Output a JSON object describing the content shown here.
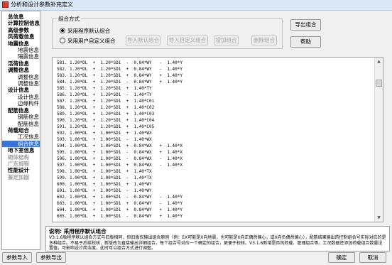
{
  "window": {
    "title": "分析和设计参数补充定义"
  },
  "sidebar": {
    "items": [
      {
        "label": "总信息",
        "level": 1,
        "state": "normal"
      },
      {
        "label": "计算控制信息",
        "level": 1,
        "state": "normal"
      },
      {
        "label": "高级参数",
        "level": 1,
        "state": "normal"
      },
      {
        "label": "风荷载信息",
        "level": 1,
        "state": "normal"
      },
      {
        "label": "地震信息",
        "level": 1,
        "state": "normal"
      },
      {
        "label": "地震信息",
        "level": 2,
        "state": "normal"
      },
      {
        "label": "隔震信息",
        "level": 2,
        "state": "normal"
      },
      {
        "label": "活荷信息",
        "level": 1,
        "state": "normal"
      },
      {
        "label": "调整信息",
        "level": 1,
        "state": "normal"
      },
      {
        "label": "调整信息1",
        "level": 2,
        "state": "normal"
      },
      {
        "label": "调整信息2",
        "level": 2,
        "state": "normal"
      },
      {
        "label": "设计信息",
        "level": 1,
        "state": "normal"
      },
      {
        "label": "设计信息",
        "level": 2,
        "state": "normal"
      },
      {
        "label": "边缘构件",
        "level": 2,
        "state": "normal"
      },
      {
        "label": "配筋信息",
        "level": 1,
        "state": "normal"
      },
      {
        "label": "钢筋信息",
        "level": 2,
        "state": "normal"
      },
      {
        "label": "配筋信息",
        "level": 2,
        "state": "normal"
      },
      {
        "label": "荷载组合",
        "level": 1,
        "state": "normal"
      },
      {
        "label": "工况信息",
        "level": 2,
        "state": "normal"
      },
      {
        "label": "组合信息",
        "level": 2,
        "state": "selected"
      },
      {
        "label": "地下室信息",
        "level": 1,
        "state": "normal"
      },
      {
        "label": "砌体结构",
        "level": 1,
        "state": "disabled"
      },
      {
        "label": "广东规程",
        "level": 1,
        "state": "disabled"
      },
      {
        "label": "性能设计",
        "level": 1,
        "state": "normal"
      },
      {
        "label": "鉴定加固",
        "level": 1,
        "state": "disabled"
      }
    ]
  },
  "combo": {
    "group_title": "组合方式",
    "radio_default": "采用程序默认组合",
    "radio_custom": "采用用户自定义组合",
    "selected": "default",
    "btn_import_default": "导入默认组合",
    "btn_import_custom": "导入自定义组合",
    "btn_add": "增加组合",
    "btn_delete": "删除组合",
    "btn_export": "导出组合",
    "btn_help": "帮助"
  },
  "combos": [
    "581. 1.20*DL  +  1.20*SD1  -  0.84*WY   -  1.40*Y",
    "582. 1.20*DL  +  1.20*SD1  +  0.84*WY   -  1.40*Y",
    "583. 1.20*DL  +  1.20*SD1  +  0.84*WY   +  1.40*Y",
    "584. 1.20*DL  +  1.20*SD1  -  0.84*WY   +  1.40*Y",
    "585. 1.20*DL  +  1.20*SD1  +  1.40*TY",
    "586. 1.20*DL  +  1.20*SD1  -  1.40*TY",
    "587. 1.20*DL  +  1.20*SD1  +  1.40*C01",
    "588. 1.20*DL  +  1.20*SD1  +  1.40*C02",
    "589. 1.20*DL  +  1.20*SD1  +  1.40*C03",
    "590. 1.20*DL  +  1.20*SD1  +  1.40*C04",
    "591. 1.20*DL  +  1.20*SD1  +  1.40*C05",
    "592. 1.00*DL  +  1.00*SD1  +  1.40*WX",
    "593. 1.00*DL  +  1.00*SD1  -  1.40*WX",
    "594. 1.00*DL  +  1.00*SD1  +  0.84*WX   +  1.40*X",
    "595. 1.00*DL  +  1.00*SD1  -  0.84*WX   +  1.40*X",
    "596. 1.00*DL  +  1.00*SD1  -  0.84*WX   -  1.40*X",
    "597. 1.00*DL  +  1.00*SD1  +  0.84*WX   -  1.40*X",
    "598. 1.00*DL  +  1.00*SD1  +  1.40*TX",
    "599. 1.00*DL  +  1.00*SD1  -  1.40*TX",
    "600. 1.00*DL  +  1.00*SD1  +  1.40*WY",
    "601. 1.00*DL  +  1.00*SD1  -  1.40*WY",
    "602. 1.00*DL  +  1.00*SD1  -  0.84*WY   -  1.40*Y",
    "603. 1.00*DL  +  1.00*SD1  +  0.84*WY   -  1.40*Y",
    "604. 1.00*DL  +  1.00*SD1  +  0.84*WY   +  1.40*Y",
    "605. 1.00*DL  +  1.00*SD1  -  0.84*WY   +  1.40*Y"
  ],
  "description": {
    "title": "说明: 采用程序默认组合",
    "body": "V3.1.6版程序默认组合方式与旧版相同，但旧版仅输出组合原则（例：EX可能是X向地震，也可能是X向正偶然偏心，或X向负偶然偏心），配筋结果输出的控制组合号实际对应的是多种组合。不易于后续校核，新版改为直接输出详细组合，每个组合号对应一个确定的组合，更便于校核。V3.1.6新增是否风荷载、管理组合等。工况数据还添加荷载组合数量设置值，可影响设计简洁度，此时可以组合方式进行调整。"
  },
  "footer": {
    "btn_import_params": "参数导入",
    "btn_export_params": "参数导出",
    "btn_ok": "确定",
    "btn_cancel": "取消"
  }
}
